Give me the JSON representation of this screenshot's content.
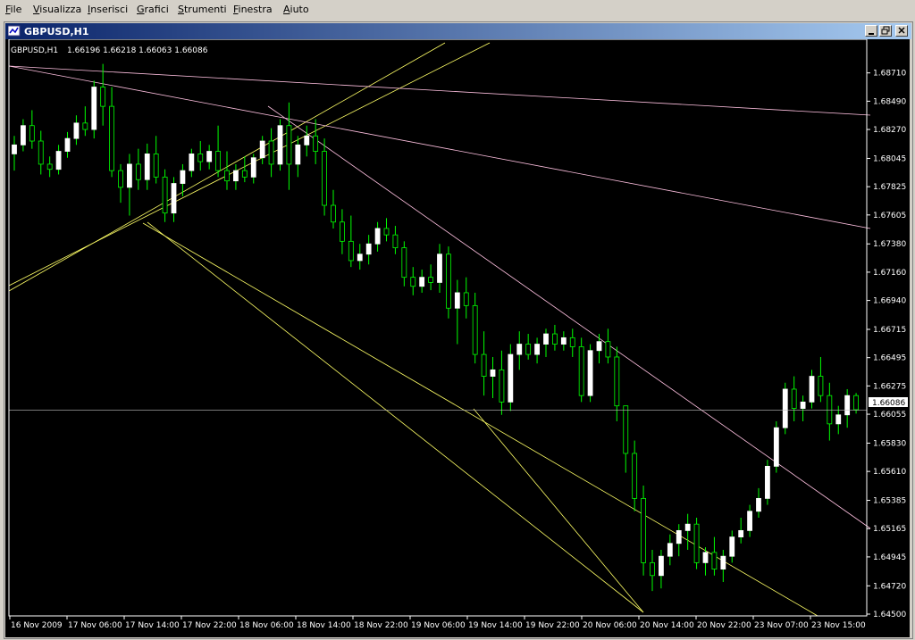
{
  "menu": [
    "File",
    "Visualizza",
    "Inserisci",
    "Grafici",
    "Strumenti",
    "Finestra",
    "Aiuto"
  ],
  "window": {
    "title": "GBPUSD,H1"
  },
  "chart_header": {
    "symbol": "GBPUSD,H1",
    "ohlc": "1.66196 1.66218 1.66063 1.66086"
  },
  "colors": {
    "bull": "#ffffff",
    "bear": "#000000",
    "wick": "#00ff00",
    "trend_yellow": "#ffff66",
    "trend_pink": "#ffc0e0",
    "bid_line": "#c0c0c0"
  },
  "chart_data": {
    "type": "candlestick",
    "price_ticks": [
      "1.68710",
      "1.68490",
      "1.68270",
      "1.68045",
      "1.67825",
      "1.67605",
      "1.67380",
      "1.67160",
      "1.66940",
      "1.66715",
      "1.66495",
      "1.66275",
      "1.66055",
      "1.65830",
      "1.65610",
      "1.65385",
      "1.65165",
      "1.64945",
      "1.64720",
      "1.64500"
    ],
    "current_price": "1.66086",
    "time_ticks": [
      "16 Nov 2009",
      "17 Nov 06:00",
      "17 Nov 14:00",
      "17 Nov 22:00",
      "18 Nov 06:00",
      "18 Nov 14:00",
      "18 Nov 22:00",
      "19 Nov 06:00",
      "19 Nov 14:00",
      "19 Nov 22:00",
      "20 Nov 06:00",
      "20 Nov 14:00",
      "20 Nov 22:00",
      "23 Nov 07:00",
      "23 Nov 15:00"
    ],
    "ylim": [
      1.645,
      1.6893
    ],
    "candles": [
      [
        1.6808,
        1.6822,
        1.6795,
        1.6815
      ],
      [
        1.6815,
        1.6835,
        1.681,
        1.683
      ],
      [
        1.683,
        1.6842,
        1.6812,
        1.6818
      ],
      [
        1.6818,
        1.6826,
        1.6792,
        1.68
      ],
      [
        1.68,
        1.6806,
        1.679,
        1.6796
      ],
      [
        1.6796,
        1.6815,
        1.6792,
        1.681
      ],
      [
        1.681,
        1.6825,
        1.6805,
        1.682
      ],
      [
        1.682,
        1.6838,
        1.6815,
        1.6832
      ],
      [
        1.6832,
        1.6845,
        1.6822,
        1.6827
      ],
      [
        1.6827,
        1.6865,
        1.682,
        1.686
      ],
      [
        1.686,
        1.6878,
        1.683,
        1.6845
      ],
      [
        1.6845,
        1.686,
        1.679,
        1.6795
      ],
      [
        1.6795,
        1.68,
        1.677,
        1.6782
      ],
      [
        1.6782,
        1.6808,
        1.676,
        1.68
      ],
      [
        1.68,
        1.6812,
        1.678,
        1.6788
      ],
      [
        1.6788,
        1.6816,
        1.678,
        1.6808
      ],
      [
        1.6808,
        1.6822,
        1.6785,
        1.679
      ],
      [
        1.679,
        1.6796,
        1.6755,
        1.6762
      ],
      [
        1.6762,
        1.679,
        1.6755,
        1.6785
      ],
      [
        1.6785,
        1.68,
        1.6775,
        1.6795
      ],
      [
        1.6795,
        1.6812,
        1.679,
        1.6808
      ],
      [
        1.6808,
        1.6818,
        1.6795,
        1.6802
      ],
      [
        1.6802,
        1.6815,
        1.6796,
        1.681
      ],
      [
        1.681,
        1.683,
        1.679,
        1.6795
      ],
      [
        1.6795,
        1.681,
        1.678,
        1.6787
      ],
      [
        1.6787,
        1.68,
        1.678,
        1.6795
      ],
      [
        1.6795,
        1.6806,
        1.6786,
        1.679
      ],
      [
        1.679,
        1.6808,
        1.6785,
        1.6805
      ],
      [
        1.6805,
        1.6822,
        1.68,
        1.6818
      ],
      [
        1.6818,
        1.6828,
        1.679,
        1.68
      ],
      [
        1.68,
        1.6835,
        1.6795,
        1.683
      ],
      [
        1.683,
        1.6848,
        1.678,
        1.68
      ],
      [
        1.68,
        1.6822,
        1.679,
        1.6815
      ],
      [
        1.6815,
        1.683,
        1.6806,
        1.6822
      ],
      [
        1.6822,
        1.6835,
        1.68,
        1.681
      ],
      [
        1.681,
        1.682,
        1.676,
        1.6768
      ],
      [
        1.6768,
        1.678,
        1.675,
        1.6755
      ],
      [
        1.6755,
        1.6765,
        1.673,
        1.674
      ],
      [
        1.674,
        1.676,
        1.672,
        1.6725
      ],
      [
        1.6725,
        1.6738,
        1.6718,
        1.673
      ],
      [
        1.673,
        1.6745,
        1.6722,
        1.6738
      ],
      [
        1.6738,
        1.6755,
        1.6732,
        1.675
      ],
      [
        1.675,
        1.6758,
        1.674,
        1.6745
      ],
      [
        1.6745,
        1.6752,
        1.673,
        1.6735
      ],
      [
        1.6735,
        1.674,
        1.6705,
        1.6712
      ],
      [
        1.6712,
        1.672,
        1.6698,
        1.6705
      ],
      [
        1.6705,
        1.6718,
        1.67,
        1.6712
      ],
      [
        1.6712,
        1.6722,
        1.6702,
        1.6708
      ],
      [
        1.6708,
        1.6738,
        1.67,
        1.673
      ],
      [
        1.673,
        1.6736,
        1.668,
        1.6688
      ],
      [
        1.6688,
        1.671,
        1.666,
        1.67
      ],
      [
        1.67,
        1.6712,
        1.668,
        1.669
      ],
      [
        1.669,
        1.67,
        1.6645,
        1.6652
      ],
      [
        1.6652,
        1.667,
        1.662,
        1.6635
      ],
      [
        1.6635,
        1.665,
        1.6618,
        1.664
      ],
      [
        1.664,
        1.6655,
        1.6605,
        1.6615
      ],
      [
        1.6615,
        1.666,
        1.6608,
        1.6652
      ],
      [
        1.6652,
        1.667,
        1.664,
        1.666
      ],
      [
        1.666,
        1.6668,
        1.6648,
        1.6652
      ],
      [
        1.6652,
        1.6665,
        1.6645,
        1.666
      ],
      [
        1.666,
        1.6672,
        1.665,
        1.6668
      ],
      [
        1.6668,
        1.6675,
        1.6655,
        1.666
      ],
      [
        1.666,
        1.667,
        1.6655,
        1.6665
      ],
      [
        1.6665,
        1.6672,
        1.665,
        1.6658
      ],
      [
        1.6658,
        1.6665,
        1.6615,
        1.662
      ],
      [
        1.662,
        1.666,
        1.6615,
        1.6655
      ],
      [
        1.6655,
        1.6668,
        1.6645,
        1.6662
      ],
      [
        1.6662,
        1.6672,
        1.6645,
        1.665
      ],
      [
        1.665,
        1.6658,
        1.66,
        1.6612
      ],
      [
        1.6612,
        1.66,
        1.656,
        1.6575
      ],
      [
        1.6575,
        1.6585,
        1.653,
        1.654
      ],
      [
        1.654,
        1.655,
        1.648,
        1.649
      ],
      [
        1.649,
        1.65,
        1.6468,
        1.648
      ],
      [
        1.648,
        1.65,
        1.647,
        1.6495
      ],
      [
        1.6495,
        1.6512,
        1.6488,
        1.6505
      ],
      [
        1.6505,
        1.652,
        1.6495,
        1.6515
      ],
      [
        1.6515,
        1.6528,
        1.65,
        1.652
      ],
      [
        1.652,
        1.6525,
        1.6485,
        1.649
      ],
      [
        1.649,
        1.6502,
        1.648,
        1.6498
      ],
      [
        1.6498,
        1.651,
        1.648,
        1.6485
      ],
      [
        1.6485,
        1.65,
        1.6475,
        1.6495
      ],
      [
        1.6495,
        1.6515,
        1.649,
        1.651
      ],
      [
        1.651,
        1.6525,
        1.6505,
        1.6515
      ],
      [
        1.6515,
        1.6535,
        1.651,
        1.653
      ],
      [
        1.653,
        1.6548,
        1.6525,
        1.654
      ],
      [
        1.654,
        1.657,
        1.6535,
        1.6565
      ],
      [
        1.6565,
        1.66,
        1.656,
        1.6595
      ],
      [
        1.6595,
        1.663,
        1.659,
        1.6625
      ],
      [
        1.6625,
        1.6635,
        1.66,
        1.661
      ],
      [
        1.661,
        1.662,
        1.66,
        1.6615
      ],
      [
        1.6615,
        1.664,
        1.661,
        1.6635
      ],
      [
        1.6635,
        1.665,
        1.6615,
        1.662
      ],
      [
        1.662,
        1.663,
        1.6585,
        1.6598
      ],
      [
        1.6598,
        1.6612,
        1.659,
        1.6605
      ],
      [
        1.6605,
        1.6625,
        1.6595,
        1.662
      ],
      [
        1.662,
        1.6622,
        1.6606,
        1.6609
      ]
    ]
  }
}
